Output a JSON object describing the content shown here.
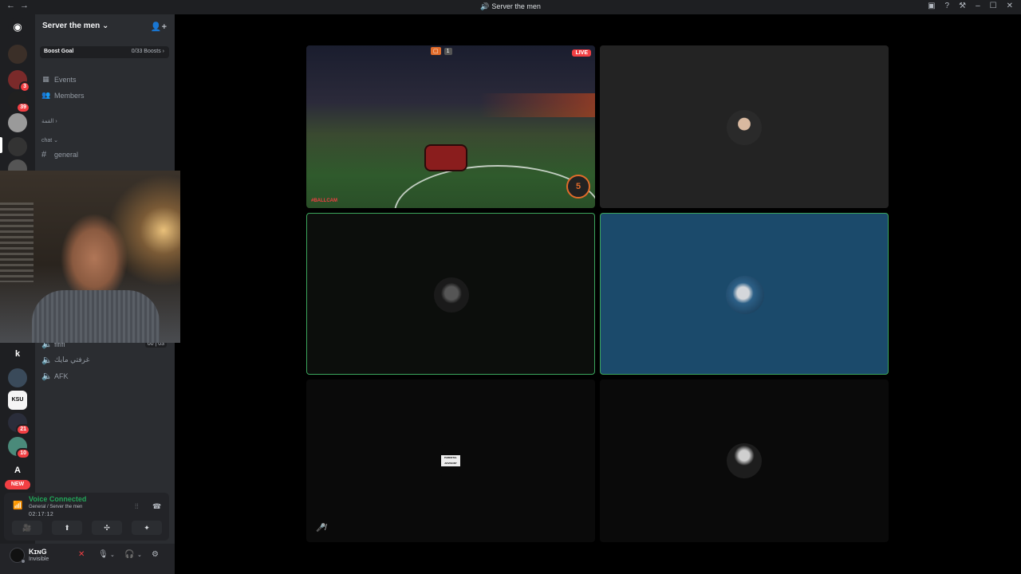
{
  "window": {
    "title": "Server the men",
    "nav_back": "←",
    "nav_forward": "→",
    "title_icon": "voice-icon",
    "controls": [
      "inbox-icon",
      "help-icon",
      "update-icon",
      "minimize-icon",
      "maximize-icon",
      "close-icon"
    ]
  },
  "guilds": {
    "items": [
      {
        "kind": "discord-home",
        "glyph": "◉"
      },
      {
        "kind": "server",
        "color": "#3b2f28"
      },
      {
        "kind": "server",
        "color": "#7a2a2a",
        "badge": "3"
      },
      {
        "kind": "server",
        "color": "#202020",
        "badge": "39"
      },
      {
        "kind": "server",
        "color": "#9a9a9a"
      },
      {
        "kind": "server",
        "color": "#333333"
      },
      {
        "kind": "server",
        "color": "#555555"
      }
    ],
    "lower": [
      {
        "kind": "letter",
        "label": "k"
      },
      {
        "kind": "server",
        "color": "#3a4a5a"
      },
      {
        "kind": "server",
        "color": "#f5f5f5",
        "label": "KSU"
      },
      {
        "kind": "server",
        "color": "#2a2d3a",
        "badge": "21"
      },
      {
        "kind": "server",
        "color": "#4a8a7a",
        "badge": "10"
      },
      {
        "kind": "letter",
        "label": "A"
      }
    ],
    "new_label": "NEW"
  },
  "sidebar": {
    "server_name": "Server the men",
    "chevron": "⌄",
    "boost_goal_label": "Boost Goal",
    "boost_count": "0/33 Boosts",
    "boost_chevron": "›",
    "nav": [
      {
        "label": "Events",
        "icon": "calendar-icon",
        "glyph": "▦"
      },
      {
        "label": "Members",
        "icon": "members-icon",
        "glyph": "👥"
      }
    ],
    "category_1": "القمة",
    "category_2": "chat",
    "text_channels": [
      {
        "name": "general"
      }
    ],
    "voice_channels": [
      {
        "name": "ﬁﬁﬁ",
        "users": "00",
        "limit": "03"
      },
      {
        "name": "غرفتي مايك"
      },
      {
        "name": "AFK"
      }
    ]
  },
  "voice_panel": {
    "status": "Voice Connected",
    "location": "General / Server the men",
    "elapsed": "02:17:12",
    "buttons": [
      {
        "name": "camera-off-button",
        "glyph": "🎥"
      },
      {
        "name": "screen-share-button",
        "glyph": "⬆"
      },
      {
        "name": "activities-button",
        "glyph": "✣"
      },
      {
        "name": "soundboard-button",
        "glyph": "✦"
      }
    ]
  },
  "user_panel": {
    "display_name": "KɪɴG",
    "status": "Invisible"
  },
  "stage": {
    "tiles": [
      {
        "id": "stream",
        "live_label": "LIVE",
        "hud": [
          "▢",
          "1"
        ],
        "boost_value": "5",
        "corner_text": "#BALLCAM"
      },
      {
        "id": "participant-2",
        "speaking": false
      },
      {
        "id": "participant-3",
        "speaking": true
      },
      {
        "id": "participant-4",
        "speaking": true
      },
      {
        "id": "participant-5",
        "speaking": false,
        "album_text": "PARENTAL ADVISORY"
      },
      {
        "id": "participant-6",
        "speaking": false
      }
    ]
  },
  "colors": {
    "speaking_border": "#3ba55c",
    "live_red": "#f23f43",
    "voice_green": "#23a559",
    "sidebar_bg": "#2b2d31",
    "guild_bg": "#1e1f22"
  }
}
